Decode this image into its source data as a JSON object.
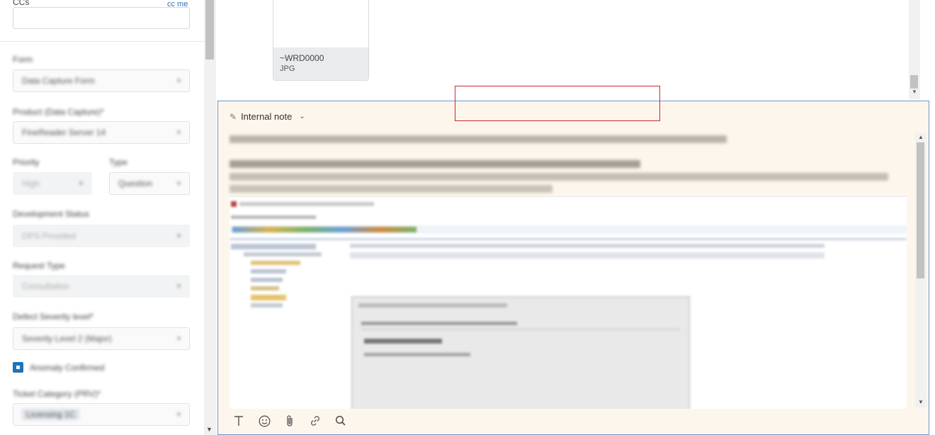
{
  "sidebar": {
    "ccs_label": "CCs",
    "cc_me": "cc me",
    "fields": [
      {
        "label": "Form",
        "value": "Data Capture Form",
        "disabled": false
      },
      {
        "label": "Product (Data Capture)*",
        "value": "FineReader Server 14",
        "disabled": false
      },
      {
        "label": "Priority",
        "value": "High",
        "disabled": true
      },
      {
        "label": "Type",
        "value": "Question",
        "disabled": false
      },
      {
        "label": "Development Status",
        "value": "OPS Provided",
        "disabled": true
      },
      {
        "label": "Request Type",
        "value": "Consultation",
        "disabled": true
      },
      {
        "label": "Defect Severity level*",
        "value": "Severity Level 2 (Major)",
        "disabled": false
      },
      {
        "label": "Ticket Category (PRV)*",
        "value": "Licensing 1C",
        "disabled": false
      }
    ],
    "checkbox_label": "Anomaly Confirmed"
  },
  "attachment": {
    "name": "~WRD0000",
    "type": "JPG"
  },
  "composer": {
    "mode_label": "Internal note",
    "toolbar": [
      "text-format",
      "emoji",
      "attachment",
      "link",
      "search"
    ]
  },
  "colors": {
    "accent": "#1f73b7",
    "composer_bg": "#fdf6ec",
    "composer_border": "#6f95c9",
    "highlight_box": "#d0262d"
  }
}
